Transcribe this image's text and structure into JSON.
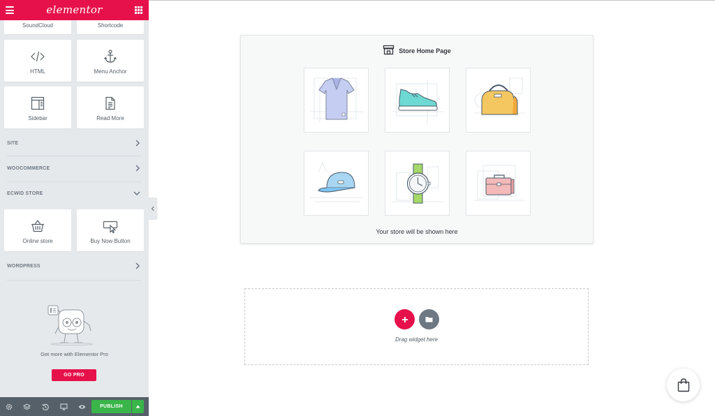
{
  "header": {
    "logo_text": "elementor",
    "brand_color": "#e6114b"
  },
  "widgets_top": [
    {
      "label": "SoundCloud",
      "icon": "soundcloud-icon"
    },
    {
      "label": "Shortcode",
      "icon": "shortcode-icon"
    }
  ],
  "widgets": [
    {
      "label": "HTML",
      "icon": "code-icon"
    },
    {
      "label": "Menu Anchor",
      "icon": "anchor-icon"
    },
    {
      "label": "Sidebar",
      "icon": "sidebar-icon"
    },
    {
      "label": "Read More",
      "icon": "document-icon"
    }
  ],
  "categories": {
    "site": "SITE",
    "woocommerce": "WOOCOMMERCE",
    "ecwid": "ECWID STORE",
    "wordpress": "WORDPRESS"
  },
  "ecwid_widgets": [
    {
      "label": "Online store",
      "icon": "basket-icon"
    },
    {
      "label": "Buy Now Button",
      "icon": "pointer-click-icon"
    }
  ],
  "promo": {
    "text": "Get more with Elementor Pro",
    "button": "GO PRO"
  },
  "footer": {
    "publish_label": "PUBLISH",
    "publish_color": "#39b54a"
  },
  "store": {
    "title": "Store Home Page",
    "caption": "Your store will be shown here",
    "products": [
      "t-shirt",
      "sneaker",
      "bag",
      "cap",
      "watch",
      "briefcase"
    ]
  },
  "dropzone": {
    "hint": "Drag widget here"
  }
}
